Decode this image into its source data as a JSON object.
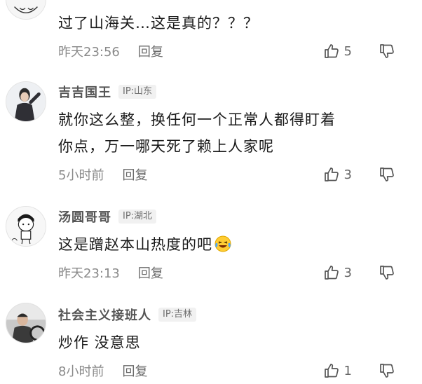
{
  "comments": [
    {
      "username": "",
      "ip": "",
      "text": "过了山海关…这是真的？？？",
      "time": "昨天23:56",
      "reply_label": "回复",
      "likes": "5",
      "avatar_icon": "sketch-avatar-icon"
    },
    {
      "username": "吉吉国王",
      "ip": "IP:山东",
      "text_line1": "就你这么整，换任何一个正常人都得盯着",
      "text_line2": "你点，万一哪天死了赖上人家呢",
      "time": "5小时前",
      "reply_label": "回复",
      "likes": "3",
      "avatar_icon": "person-photo-avatar-icon"
    },
    {
      "username": "汤圆哥哥",
      "ip": "IP:湖北",
      "text": "这是蹭赵本山热度的吧",
      "emoji": "laughing-crying-emoji",
      "time": "昨天23:13",
      "reply_label": "回复",
      "likes": "3",
      "avatar_icon": "cartoon-boy-avatar-icon"
    },
    {
      "username": "社会主义接班人",
      "ip": "IP:吉林",
      "text": "炒作 没意思",
      "time": "8小时前",
      "reply_label": "回复",
      "likes": "1",
      "avatar_icon": "driver-photo-avatar-icon"
    }
  ],
  "icons": {
    "like": "thumbs-up-icon",
    "dislike": "thumbs-down-icon"
  }
}
